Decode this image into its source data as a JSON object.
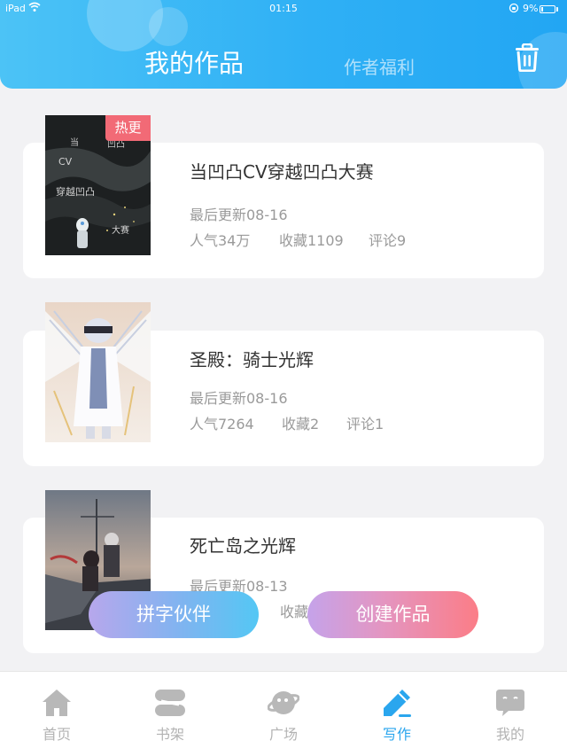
{
  "status_bar": {
    "device": "iPad",
    "time": "01:15",
    "battery": "9%"
  },
  "header": {
    "tabs": [
      {
        "label": "我的作品",
        "active": true
      },
      {
        "label": "作者福利",
        "active": false
      }
    ],
    "delete_icon": "trash-icon"
  },
  "works": [
    {
      "title": "当凹凸CV穿越凹凸大赛",
      "badge": "热更",
      "cover_text": [
        "当",
        "凹凸",
        "CV",
        "穿越凹凸",
        "大赛"
      ],
      "updated": "最后更新08-16",
      "popularity": "人气34万",
      "favorites": "收藏1109",
      "comments": "评论9"
    },
    {
      "title": "圣殿：骑士光辉",
      "updated": "最后更新08-16",
      "popularity": "人气7264",
      "favorites": "收藏2",
      "comments": "评论1"
    },
    {
      "title": "死亡岛之光辉",
      "updated": "最后更新08-13",
      "favorites": "收藏"
    }
  ],
  "actions": {
    "partner_label": "拼字伙伴",
    "create_label": "创建作品"
  },
  "bottom_nav": {
    "items": [
      {
        "label": "首页",
        "icon": "home-icon"
      },
      {
        "label": "书架",
        "icon": "bookshelf-icon"
      },
      {
        "label": "广场",
        "icon": "planet-icon"
      },
      {
        "label": "写作",
        "icon": "pen-icon",
        "active": true
      },
      {
        "label": "我的",
        "icon": "chat-bubble-icon"
      }
    ]
  },
  "colors": {
    "header_start": "#4cc3f6",
    "header_end": "#22a6f3",
    "active_nav": "#2aa6ee",
    "badge": "#f26a76"
  }
}
